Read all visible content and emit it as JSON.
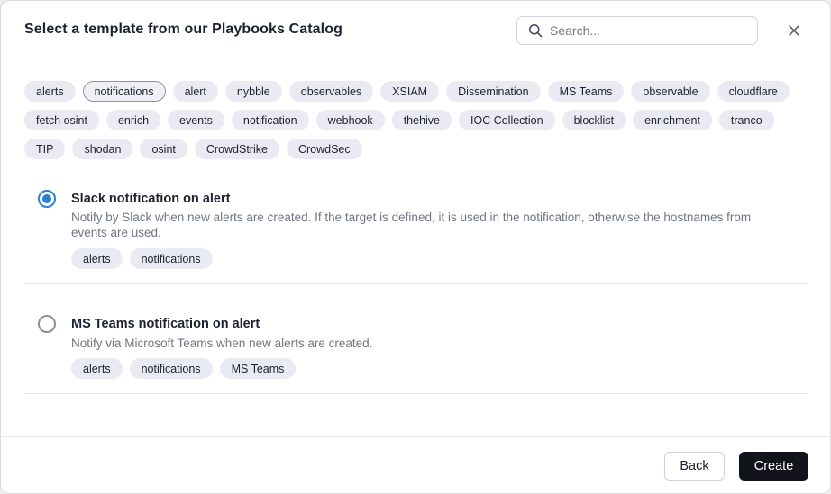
{
  "header": {
    "title": "Select a template from our Playbooks Catalog",
    "search_placeholder": "Search..."
  },
  "filter_tags": {
    "rows": [
      [
        "alerts",
        "notifications",
        "alert",
        "nybble",
        "observables",
        "XSIAM",
        "Dissemination",
        "MS Teams",
        "observable",
        "cloudflare"
      ],
      [
        "fetch osint",
        "enrich",
        "events",
        "notification",
        "webhook",
        "thehive",
        "IOC Collection",
        "blocklist",
        "enrichment",
        "tranco"
      ],
      [
        "TIP",
        "shodan",
        "osint",
        "CrowdStrike",
        "CrowdSec"
      ]
    ],
    "selected": "notifications"
  },
  "templates": [
    {
      "name": "Slack notification on alert",
      "description": "Notify by Slack when new alerts are created. If the target is defined, it is used in the notification, otherwise the hostnames from events are used.",
      "tags": [
        "alerts",
        "notifications"
      ],
      "selected": true
    },
    {
      "name": "MS Teams notification on alert",
      "description": "Notify via Microsoft Teams when new alerts are created.",
      "tags": [
        "alerts",
        "notifications",
        "MS Teams"
      ],
      "selected": false
    }
  ],
  "footer": {
    "back_label": "Back",
    "create_label": "Create"
  },
  "colors": {
    "accent": "#2b7fd6",
    "primary_button": "#12141b",
    "tag_bg": "#eaebf2",
    "muted_text": "#6f7585"
  },
  "icons": {
    "search": "search-icon",
    "close": "close-icon"
  }
}
